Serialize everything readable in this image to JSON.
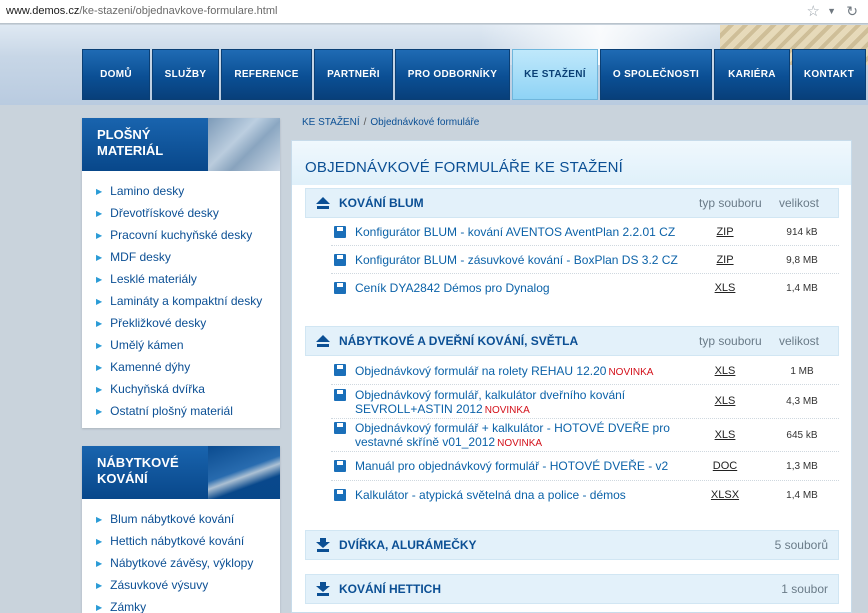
{
  "address_bar": {
    "host": "www.demos.cz",
    "path": "/ke-stazeni/objednavkove-formulare.html"
  },
  "nav": {
    "items": [
      {
        "label": "DOMŮ",
        "active": false
      },
      {
        "label": "SLUŽBY",
        "active": false
      },
      {
        "label": "REFERENCE",
        "active": false
      },
      {
        "label": "PARTNEŘI",
        "active": false
      },
      {
        "label": "PRO ODBORNÍKY",
        "active": false
      },
      {
        "label": "KE STAŽENÍ",
        "active": true
      },
      {
        "label": "O SPOLEČNOSTI",
        "active": false
      },
      {
        "label": "KARIÉRA",
        "active": false
      },
      {
        "label": "KONTAKT",
        "active": false
      }
    ]
  },
  "sidebar": {
    "box1": {
      "title_line1": "PLOŠNÝ",
      "title_line2": "MATERIÁL",
      "items": [
        "Lamino desky",
        "Dřevotřískové desky",
        "Pracovní kuchyňské desky",
        "MDF desky",
        "Lesklé materiály",
        "Lamináty a kompaktní desky",
        "Překližkové desky",
        "Umělý kámen",
        "Kamenné dýhy",
        "Kuchyňská dvířka",
        "Ostatní plošný materiál"
      ]
    },
    "box2": {
      "title_line1": "NÁBYTKOVÉ",
      "title_line2": "KOVÁNÍ",
      "items": [
        "Blum nábytkové kování",
        "Hettich nábytkové kování",
        "Nábytkové závěsy, výklopy",
        "Zásuvkové výsuvy",
        "Zámky"
      ]
    }
  },
  "breadcrumb": {
    "root": "KE STAŽENÍ",
    "separator": "/",
    "current": "Objednávkové formuláře"
  },
  "main": {
    "title": "OBJEDNÁVKOVÉ FORMULÁŘE KE STAŽENÍ",
    "col_type": "typ souboru",
    "col_size": "velikost",
    "sections": [
      {
        "title": "KOVÁNÍ BLUM",
        "expanded": true,
        "rows": [
          {
            "name": "Konfigurátor BLUM - kování AVENTOS AventPlan 2.2.01 CZ",
            "badge": "",
            "type": "ZIP",
            "size": "914 kB"
          },
          {
            "name": "Konfigurátor BLUM - zásuvkové kování - BoxPlan DS 3.2 CZ",
            "badge": "",
            "type": "ZIP",
            "size": "9,8 MB"
          },
          {
            "name": "Ceník DYA2842 Démos pro Dynalog",
            "badge": "",
            "type": "XLS",
            "size": "1,4 MB"
          }
        ]
      },
      {
        "title": "NÁBYTKOVÉ A DVEŘNÍ KOVÁNÍ, SVĚTLA",
        "expanded": true,
        "rows": [
          {
            "name": "Objednávkový formulář na rolety REHAU 12.20",
            "badge": "NOVINKA",
            "type": "XLS",
            "size": "1 MB"
          },
          {
            "name_line1": "Objednávkový formulář, kalkulátor dveřního kování",
            "name_line2": "SEVROLL+ASTIN 2012",
            "badge": "NOVINKA",
            "type": "XLS",
            "size": "4,3 MB"
          },
          {
            "name_line1": "Objednávkový formulář + kalkulátor - HOTOVÉ DVEŘE pro",
            "name_line2": "vestavné skříně v01_2012",
            "badge": "NOVINKA",
            "type": "XLS",
            "size": "645 kB"
          },
          {
            "name": "Manuál pro objednávkový formulář - HOTOVÉ DVEŘE - v2",
            "badge": "",
            "type": "DOC",
            "size": "1,3 MB"
          },
          {
            "name": "Kalkulátor - atypická světelná dna a police - démos",
            "badge": "",
            "type": "XLSX",
            "size": "1,4 MB"
          }
        ]
      },
      {
        "title": "DVÍŘKA, ALURÁMEČKY",
        "expanded": false,
        "count": "5 souborů"
      },
      {
        "title": "KOVÁNÍ HETTICH",
        "expanded": false,
        "count": "1 soubor"
      }
    ]
  },
  "colors": {
    "nav_blue": "#0b4f94",
    "nav_active": "#8fd3f5",
    "link_blue": "#0b62a8",
    "badge_red": "#d3101a",
    "section_bg": "#e3f1fa"
  }
}
